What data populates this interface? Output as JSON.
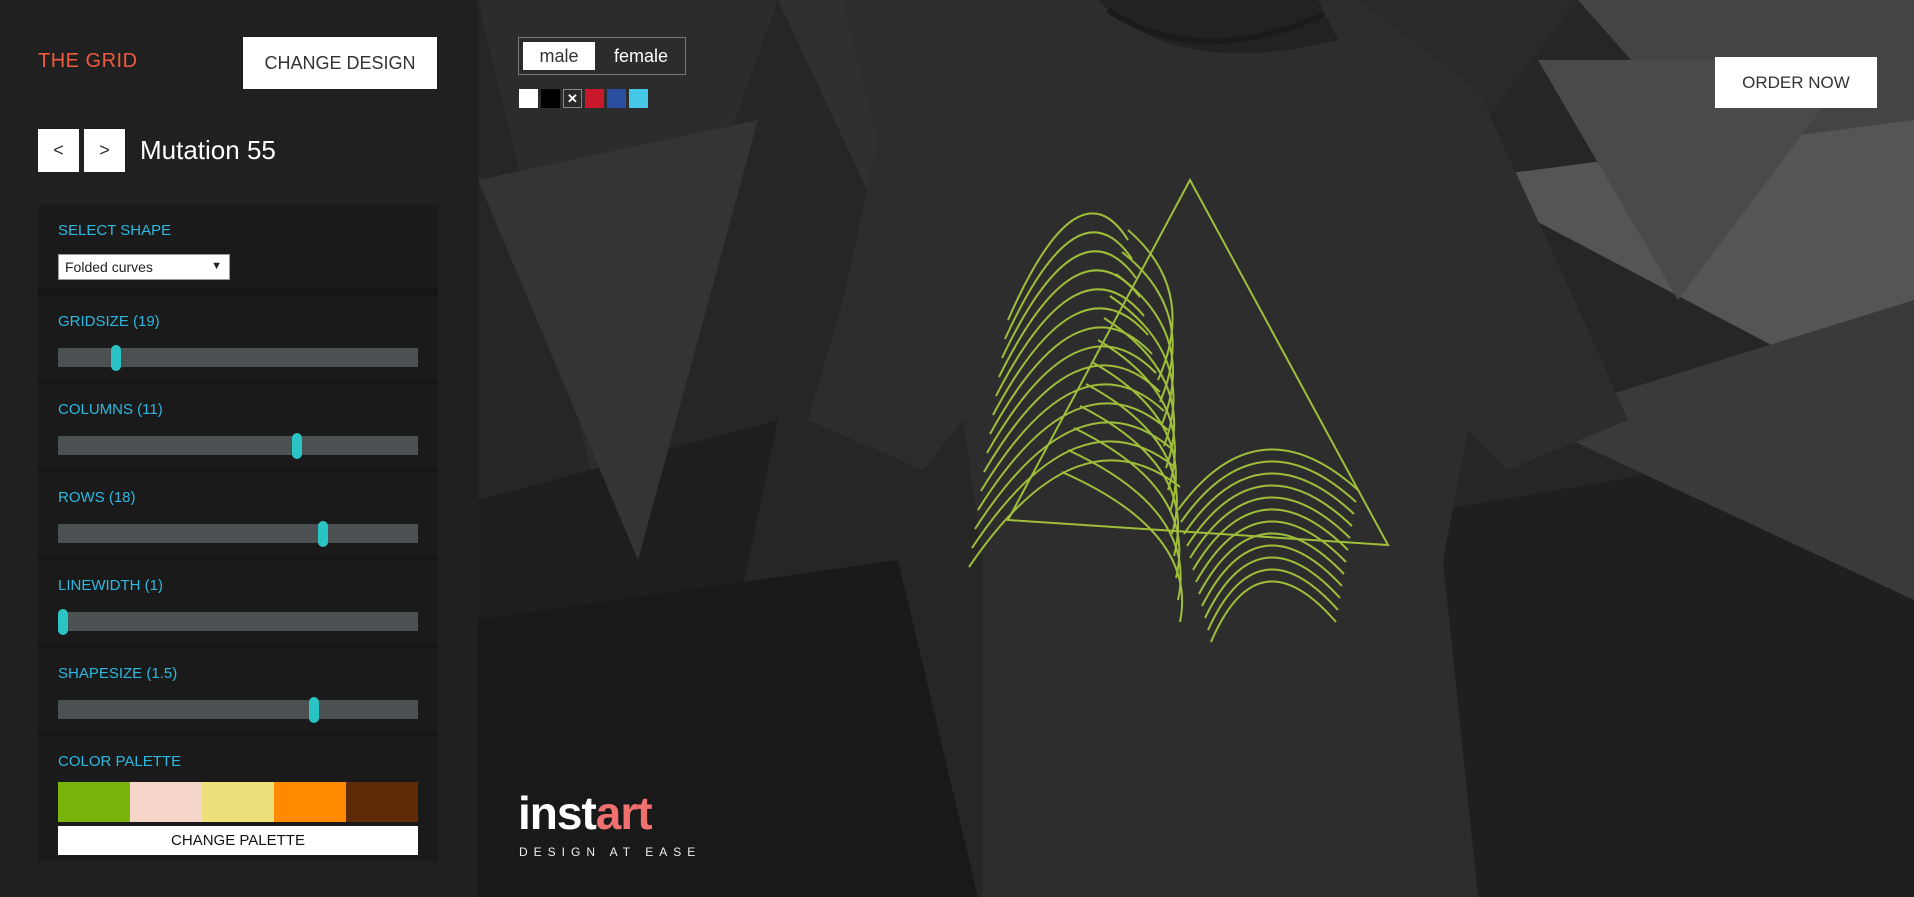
{
  "sidebar": {
    "brand": "THE GRID",
    "change_design": "CHANGE DESIGN",
    "prev_label": "<",
    "next_label": ">",
    "title": "Mutation 55",
    "shape": {
      "label": "SELECT SHAPE",
      "selected": "Folded curves"
    },
    "sliders": [
      {
        "label": "GRIDSIZE (19)",
        "value": 0.16
      },
      {
        "label": "COLUMNS (11)",
        "value": 0.665
      },
      {
        "label": "ROWS (18)",
        "value": 0.735
      },
      {
        "label": "LINEWIDTH (1)",
        "value": 0.0
      },
      {
        "label": "SHAPESIZE (1.5)",
        "value": 0.71
      }
    ],
    "palette": {
      "label": "COLOR PALETTE",
      "colors": [
        "#7ab40a",
        "#f5d6c8",
        "#ece07c",
        "#ff8a00",
        "#5e2a08"
      ],
      "change_label": "CHANGE PALETTE"
    }
  },
  "stage": {
    "gender": {
      "male": "male",
      "female": "female",
      "selected": "male"
    },
    "shirt_colors": [
      "#ffffff",
      "#000000",
      "#2a2a2a",
      "#c8182a",
      "#2a4fa0",
      "#45c8e8"
    ],
    "selected_color_mark": "✕",
    "order_now": "ORDER NOW",
    "logo": {
      "part1": "inst",
      "part2": "art",
      "tagline": "DESIGN AT EASE"
    },
    "design_color": "#9fbf3a"
  }
}
